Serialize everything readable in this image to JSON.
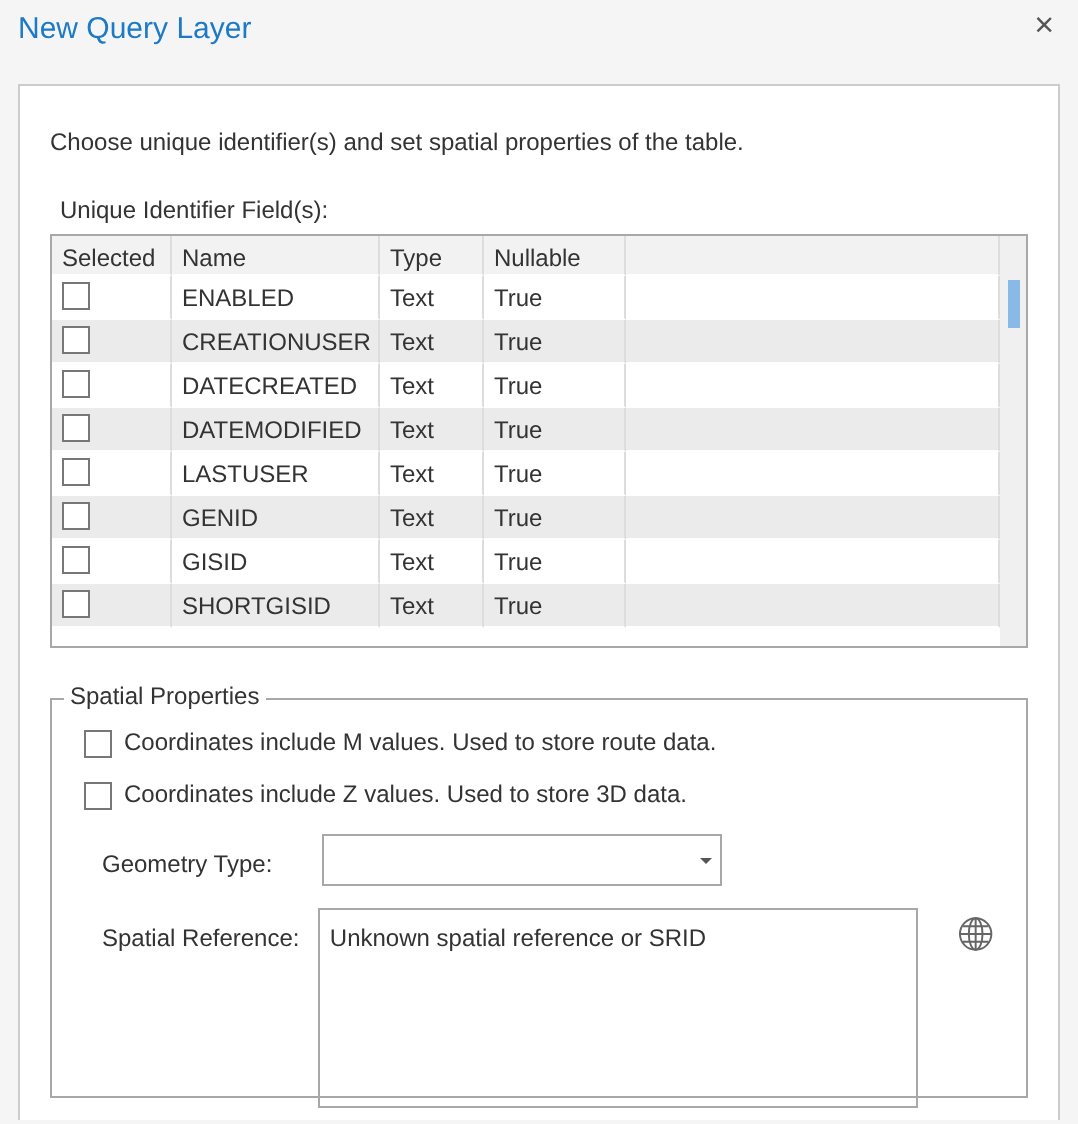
{
  "window": {
    "title": "New Query Layer",
    "close": "×"
  },
  "description": "Choose unique identifier(s) and set spatial properties of the table.",
  "unique_fields": {
    "label": "Unique Identifier Field(s):",
    "columns": [
      "Selected",
      "Name",
      "Type",
      "Nullable"
    ],
    "rows": [
      {
        "selected": false,
        "name": "ENABLED",
        "type": "Text",
        "nullable": "True"
      },
      {
        "selected": false,
        "name": "CREATIONUSER",
        "type": "Text",
        "nullable": "True"
      },
      {
        "selected": false,
        "name": "DATECREATED",
        "type": "Text",
        "nullable": "True"
      },
      {
        "selected": false,
        "name": "DATEMODIFIED",
        "type": "Text",
        "nullable": "True"
      },
      {
        "selected": false,
        "name": "LASTUSER",
        "type": "Text",
        "nullable": "True"
      },
      {
        "selected": false,
        "name": "GENID",
        "type": "Text",
        "nullable": "True"
      },
      {
        "selected": false,
        "name": "GISID",
        "type": "Text",
        "nullable": "True"
      },
      {
        "selected": false,
        "name": "SHORTGISID",
        "type": "Text",
        "nullable": "True"
      }
    ]
  },
  "spatial_properties": {
    "title": "Spatial Properties",
    "options": [
      {
        "label": "Coordinates include M values. Used to store route data.",
        "checked": false
      },
      {
        "label": "Coordinates include Z values. Used to store 3D data.",
        "checked": false
      }
    ],
    "geometry_type": {
      "label": "Geometry Type:"
    },
    "spatial_reference": {
      "label": "Spatial Reference:",
      "value": "Unknown spatial reference or SRID"
    }
  }
}
